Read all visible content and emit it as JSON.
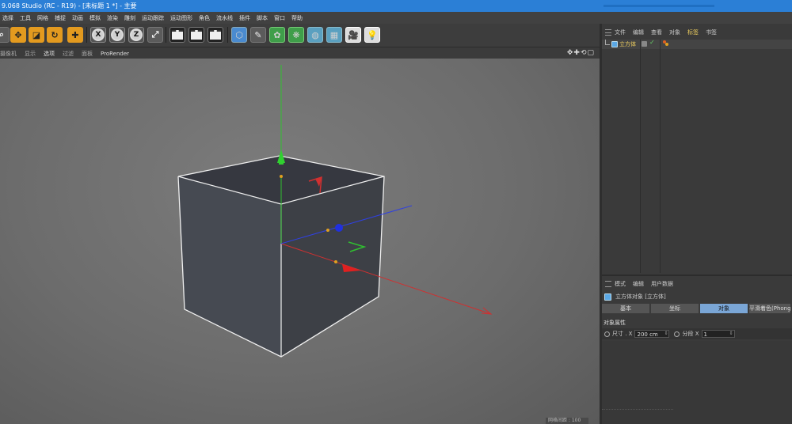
{
  "window": {
    "title": "9.068 Studio (RC - R19) - [未标题 1 *] - 主要"
  },
  "menu": {
    "items": [
      "选择",
      "工具",
      "网格",
      "捕捉",
      "动画",
      "模拟",
      "渲染",
      "雕刻",
      "运动跟踪",
      "运动图形",
      "角色",
      "流水线",
      "插件",
      "脚本",
      "窗口",
      "帮助"
    ]
  },
  "toolbar": {
    "axis_x": "X",
    "axis_y": "Y",
    "axis_z": "Z"
  },
  "viewport_menu": {
    "items": [
      "摄像机",
      "显示",
      "选项",
      "过滤",
      "面板",
      "ProRender"
    ],
    "nav_icons": "✥✚⟲▢"
  },
  "viewport": {
    "status": "网格间距 : 100"
  },
  "object_manager": {
    "menu": [
      "文件",
      "编辑",
      "查看",
      "对象",
      "标签",
      "书签"
    ],
    "object_name": "立方体",
    "check": "✓"
  },
  "attribute_manager": {
    "menu": [
      "模式",
      "编辑",
      "用户数据"
    ],
    "title": "立方体对象 [立方体]",
    "tabs": [
      "基本",
      "坐标",
      "对象",
      "平滑着色(Phong)"
    ],
    "active_tab": "对象",
    "section": "对象属性",
    "size_label": "尺寸 . X",
    "size_value": "200 cm",
    "segments_label": "分段 X",
    "segments_value": "1"
  },
  "colors": {
    "accent_blue": "#2b7fd6",
    "highlight_yellow": "#f0d060",
    "tab_active": "#7aa6d6",
    "axis_x": "#e03030",
    "axis_y": "#30c030",
    "axis_z": "#3040e0"
  }
}
